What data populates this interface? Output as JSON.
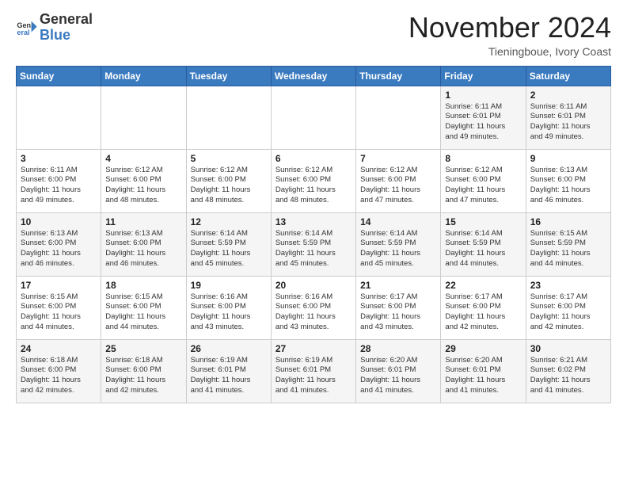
{
  "header": {
    "logo_general": "General",
    "logo_blue": "Blue",
    "month_title": "November 2024",
    "location": "Tieningboue, Ivory Coast"
  },
  "days_of_week": [
    "Sunday",
    "Monday",
    "Tuesday",
    "Wednesday",
    "Thursday",
    "Friday",
    "Saturday"
  ],
  "weeks": [
    [
      {
        "day": "",
        "info": ""
      },
      {
        "day": "",
        "info": ""
      },
      {
        "day": "",
        "info": ""
      },
      {
        "day": "",
        "info": ""
      },
      {
        "day": "",
        "info": ""
      },
      {
        "day": "1",
        "info": "Sunrise: 6:11 AM\nSunset: 6:01 PM\nDaylight: 11 hours\nand 49 minutes."
      },
      {
        "day": "2",
        "info": "Sunrise: 6:11 AM\nSunset: 6:01 PM\nDaylight: 11 hours\nand 49 minutes."
      }
    ],
    [
      {
        "day": "3",
        "info": "Sunrise: 6:11 AM\nSunset: 6:00 PM\nDaylight: 11 hours\nand 49 minutes."
      },
      {
        "day": "4",
        "info": "Sunrise: 6:12 AM\nSunset: 6:00 PM\nDaylight: 11 hours\nand 48 minutes."
      },
      {
        "day": "5",
        "info": "Sunrise: 6:12 AM\nSunset: 6:00 PM\nDaylight: 11 hours\nand 48 minutes."
      },
      {
        "day": "6",
        "info": "Sunrise: 6:12 AM\nSunset: 6:00 PM\nDaylight: 11 hours\nand 48 minutes."
      },
      {
        "day": "7",
        "info": "Sunrise: 6:12 AM\nSunset: 6:00 PM\nDaylight: 11 hours\nand 47 minutes."
      },
      {
        "day": "8",
        "info": "Sunrise: 6:12 AM\nSunset: 6:00 PM\nDaylight: 11 hours\nand 47 minutes."
      },
      {
        "day": "9",
        "info": "Sunrise: 6:13 AM\nSunset: 6:00 PM\nDaylight: 11 hours\nand 46 minutes."
      }
    ],
    [
      {
        "day": "10",
        "info": "Sunrise: 6:13 AM\nSunset: 6:00 PM\nDaylight: 11 hours\nand 46 minutes."
      },
      {
        "day": "11",
        "info": "Sunrise: 6:13 AM\nSunset: 6:00 PM\nDaylight: 11 hours\nand 46 minutes."
      },
      {
        "day": "12",
        "info": "Sunrise: 6:14 AM\nSunset: 5:59 PM\nDaylight: 11 hours\nand 45 minutes."
      },
      {
        "day": "13",
        "info": "Sunrise: 6:14 AM\nSunset: 5:59 PM\nDaylight: 11 hours\nand 45 minutes."
      },
      {
        "day": "14",
        "info": "Sunrise: 6:14 AM\nSunset: 5:59 PM\nDaylight: 11 hours\nand 45 minutes."
      },
      {
        "day": "15",
        "info": "Sunrise: 6:14 AM\nSunset: 5:59 PM\nDaylight: 11 hours\nand 44 minutes."
      },
      {
        "day": "16",
        "info": "Sunrise: 6:15 AM\nSunset: 5:59 PM\nDaylight: 11 hours\nand 44 minutes."
      }
    ],
    [
      {
        "day": "17",
        "info": "Sunrise: 6:15 AM\nSunset: 6:00 PM\nDaylight: 11 hours\nand 44 minutes."
      },
      {
        "day": "18",
        "info": "Sunrise: 6:15 AM\nSunset: 6:00 PM\nDaylight: 11 hours\nand 44 minutes."
      },
      {
        "day": "19",
        "info": "Sunrise: 6:16 AM\nSunset: 6:00 PM\nDaylight: 11 hours\nand 43 minutes."
      },
      {
        "day": "20",
        "info": "Sunrise: 6:16 AM\nSunset: 6:00 PM\nDaylight: 11 hours\nand 43 minutes."
      },
      {
        "day": "21",
        "info": "Sunrise: 6:17 AM\nSunset: 6:00 PM\nDaylight: 11 hours\nand 43 minutes."
      },
      {
        "day": "22",
        "info": "Sunrise: 6:17 AM\nSunset: 6:00 PM\nDaylight: 11 hours\nand 42 minutes."
      },
      {
        "day": "23",
        "info": "Sunrise: 6:17 AM\nSunset: 6:00 PM\nDaylight: 11 hours\nand 42 minutes."
      }
    ],
    [
      {
        "day": "24",
        "info": "Sunrise: 6:18 AM\nSunset: 6:00 PM\nDaylight: 11 hours\nand 42 minutes."
      },
      {
        "day": "25",
        "info": "Sunrise: 6:18 AM\nSunset: 6:00 PM\nDaylight: 11 hours\nand 42 minutes."
      },
      {
        "day": "26",
        "info": "Sunrise: 6:19 AM\nSunset: 6:01 PM\nDaylight: 11 hours\nand 41 minutes."
      },
      {
        "day": "27",
        "info": "Sunrise: 6:19 AM\nSunset: 6:01 PM\nDaylight: 11 hours\nand 41 minutes."
      },
      {
        "day": "28",
        "info": "Sunrise: 6:20 AM\nSunset: 6:01 PM\nDaylight: 11 hours\nand 41 minutes."
      },
      {
        "day": "29",
        "info": "Sunrise: 6:20 AM\nSunset: 6:01 PM\nDaylight: 11 hours\nand 41 minutes."
      },
      {
        "day": "30",
        "info": "Sunrise: 6:21 AM\nSunset: 6:02 PM\nDaylight: 11 hours\nand 41 minutes."
      }
    ]
  ]
}
